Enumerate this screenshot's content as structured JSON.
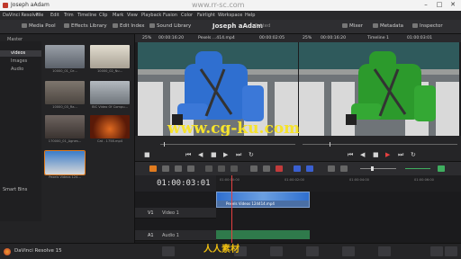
{
  "window": {
    "title": "Joseph aAdam",
    "min": "–",
    "max": "□",
    "close": "✕"
  },
  "menu": {
    "items": [
      "DaVinci Resolve",
      "File",
      "Edit",
      "Trim",
      "Timeline",
      "Clip",
      "Mark",
      "View",
      "Playback",
      "Fusion",
      "Color",
      "Fairlight",
      "Workspace",
      "Help"
    ]
  },
  "toolbar": {
    "media_pool": "Media Pool",
    "effects_library": "Effects Library",
    "edit_index": "Edit Index",
    "sound_library": "Sound Library",
    "project_name": "Joseph aAdam",
    "project_status": "Edited",
    "mixer": "Mixer",
    "metadata": "Metadata",
    "inspector": "Inspector"
  },
  "bins": {
    "master": "Master",
    "items": [
      "videos",
      "Images",
      "Audio"
    ],
    "selected": "videos",
    "smart_bins": "Smart Bins"
  },
  "clips": [
    {
      "caption": "10000_01_Ce...",
      "color": "#8a8f96"
    },
    {
      "caption": "10000_02_Nu...",
      "color": "#c9c2b2"
    },
    {
      "caption": "10000_03_Ra...",
      "color": "#6f6a63"
    },
    {
      "caption": "BIC Video Of Compu...",
      "color": "#9aa0a6"
    },
    {
      "caption": "170000_01_Agnes...",
      "color": "#5e5550"
    },
    {
      "caption": "Cat - 1758.mp4",
      "color": "#8b2b12"
    },
    {
      "caption": "Pexels Videos 124...",
      "color": "#3a6aa8"
    }
  ],
  "viewer_header": {
    "zoom_a": "25%",
    "tc_a": "00:00:16:20",
    "clip_name": "Pexels ...414.mp4",
    "tc_dur": "00:00:02:05",
    "zoom_b": "25%",
    "tc_b": "00:00:16:20",
    "timeline_name": "Timeline 1",
    "tc_right": "01:00:03:01"
  },
  "timeline": {
    "timecode": "01:00:03:01",
    "tracks": [
      {
        "id": "V1",
        "name": "Video 1"
      },
      {
        "id": "A1",
        "name": "Audio 1"
      }
    ],
    "clip_label": "Pexels Videos 124414.mp4",
    "ruler_marks": [
      "01:00:00:00",
      "01:00:02:00",
      "01:00:04:00",
      "01:00:06:00",
      "01:00:08:00"
    ]
  },
  "app": {
    "name": "DaVinci Resolve 15"
  },
  "watermarks": {
    "top": "www.rr-sc.com",
    "center": "www.cg-ku.com",
    "bottom": "人人素材"
  },
  "colors": {
    "accent": "#e07b1f",
    "clip_blue": "#4a6fa5",
    "playhead": "#e64040",
    "audio_green": "#2f7a4b",
    "watermark_yellow": "#f6e32c"
  }
}
